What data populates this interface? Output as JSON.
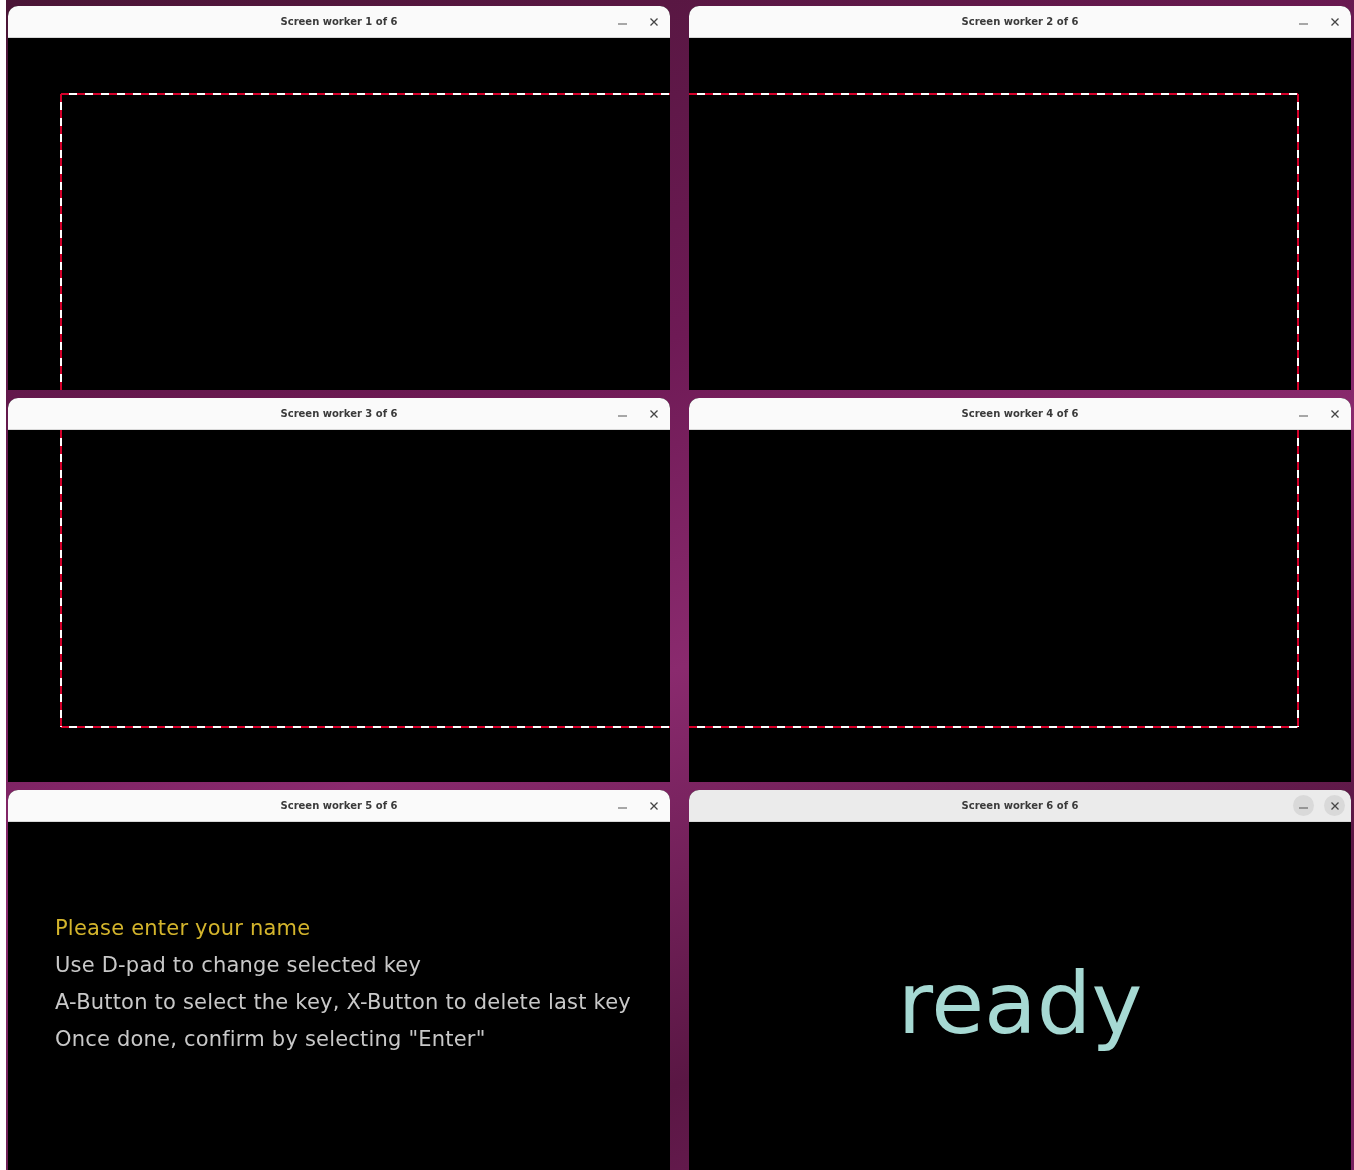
{
  "windows": [
    {
      "title": "Screen worker 1 of 6",
      "focused": false,
      "kind": "frame"
    },
    {
      "title": "Screen worker 2 of 6",
      "focused": false,
      "kind": "frame"
    },
    {
      "title": "Screen worker 3 of 6",
      "focused": false,
      "kind": "frame"
    },
    {
      "title": "Screen worker 4 of 6",
      "focused": false,
      "kind": "frame"
    },
    {
      "title": "Screen worker 5 of 6",
      "focused": false,
      "kind": "instructions",
      "lines": [
        {
          "text": "Please enter your name",
          "color": "#d4b52c"
        },
        {
          "text": "Use D-pad to change selected key",
          "color": "#c8c8c8"
        },
        {
          "text": "A-Button to select the key, X-Button to delete last key",
          "color": "#c8c8c8"
        },
        {
          "text": "Once done, confirm by selecting \"Enter\"",
          "color": "#c8c8c8"
        }
      ]
    },
    {
      "title": "Screen worker 6 of 6",
      "focused": true,
      "kind": "status",
      "status": "ready"
    }
  ]
}
